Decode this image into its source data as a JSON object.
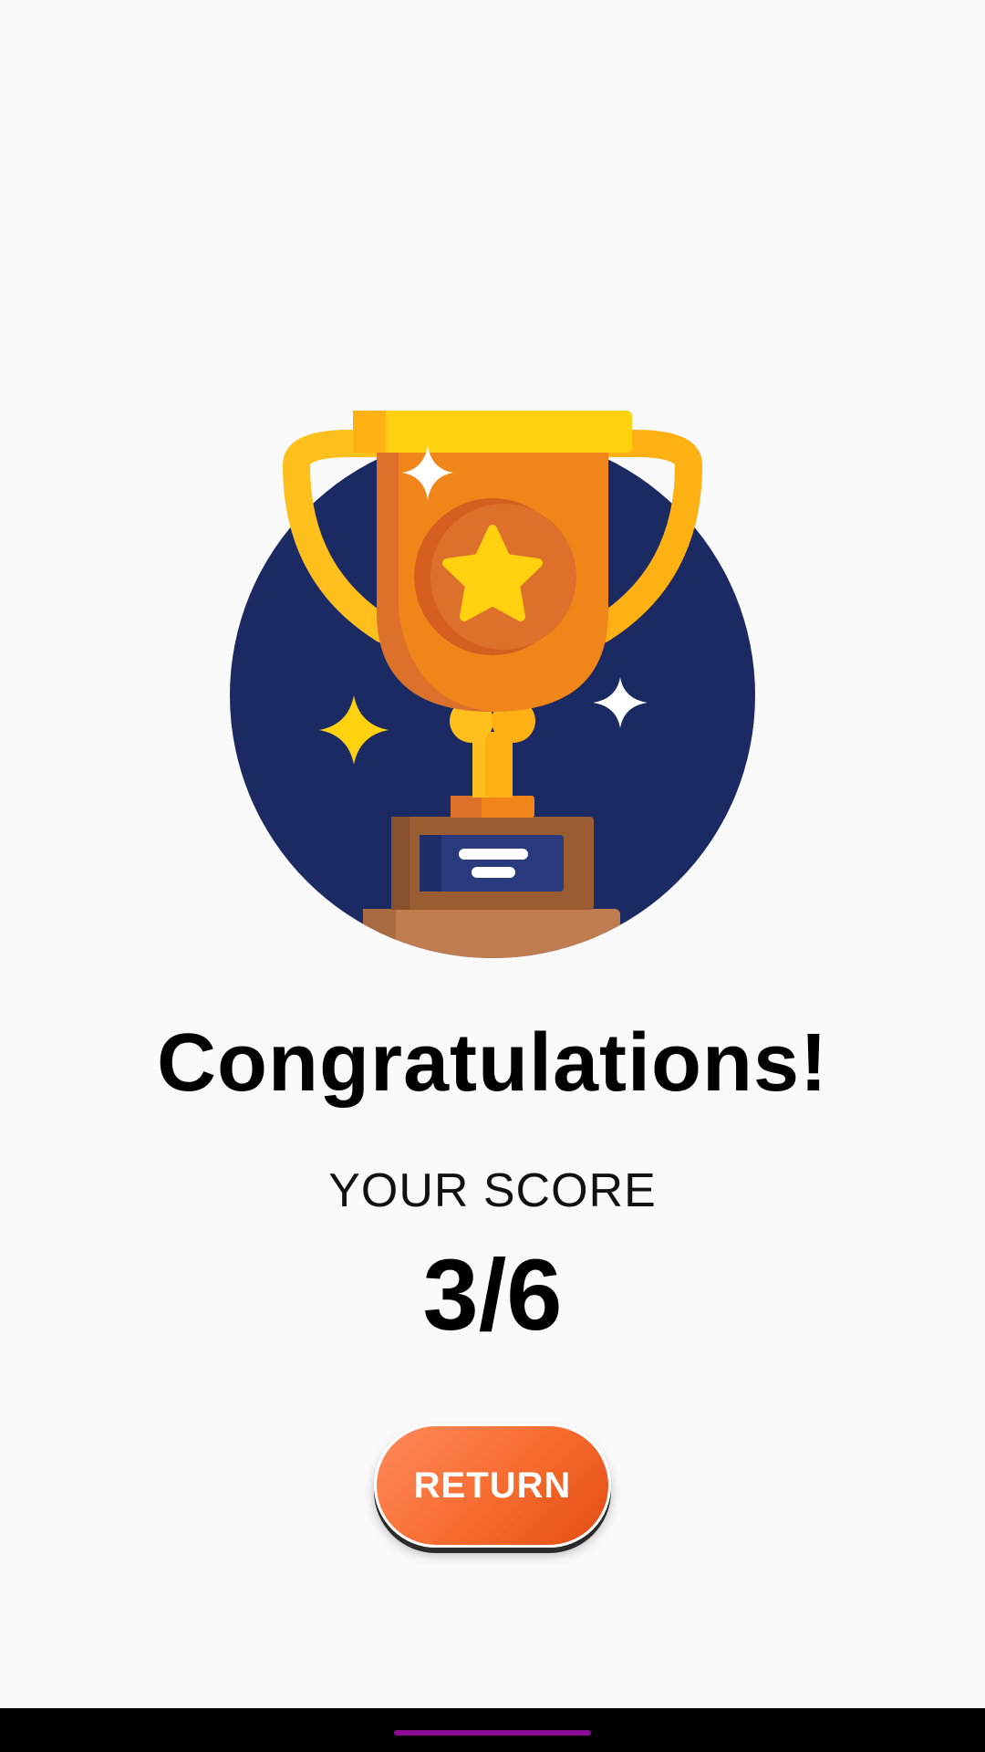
{
  "screen": {
    "headline": "Congratulations!",
    "score_label": "YOUR SCORE",
    "score_value": "3/6",
    "return_label": "RETURN"
  },
  "illustration": {
    "name": "trophy-icon",
    "background_circle_color": "#1b2a63",
    "cup_color": "#f0861a",
    "handle_color": "#ffc01d",
    "medal_color": "#dd712c",
    "star_color": "#ffd10f",
    "base_color": "#9a5d31",
    "plinth_color": "#bf7c4f",
    "plaque_color": "#2b3a7e"
  },
  "colors": {
    "background": "#fafafa",
    "button_gradient_start": "#ff8a5c",
    "button_gradient_end": "#e24d14",
    "nav_bar": "#000000",
    "nav_handle": "#8a0b8f"
  }
}
